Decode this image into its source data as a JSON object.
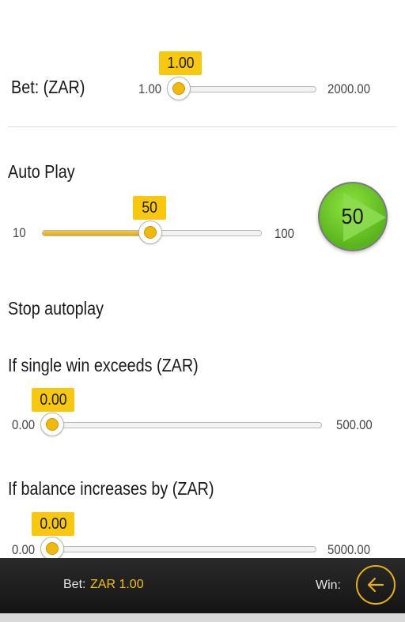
{
  "bet": {
    "label": "Bet: (ZAR)",
    "min": "1.00",
    "max": "2000.00",
    "value": "1.00",
    "fraction": 0.0
  },
  "autoplay": {
    "label": "Auto Play",
    "min": "10",
    "max": "100",
    "value": "50",
    "fraction": 0.444,
    "button_value": "50"
  },
  "stop": {
    "heading": "Stop autoplay",
    "single_win": {
      "label": "If single win exceeds (ZAR)",
      "min": "0.00",
      "max": "500.00",
      "value": "0.00",
      "fraction": 0.0
    },
    "balance": {
      "label": "If balance increases by (ZAR)",
      "min": "0.00",
      "max": "5000.00",
      "value": "0.00",
      "fraction": 0.0
    }
  },
  "footer": {
    "bet_label": "Bet:",
    "bet_value": "ZAR 1.00",
    "win_label": "Win:"
  },
  "colors": {
    "accent": "#f7c80e",
    "play_green": "#59b51d",
    "footer_bg": "#1e1e1e"
  }
}
